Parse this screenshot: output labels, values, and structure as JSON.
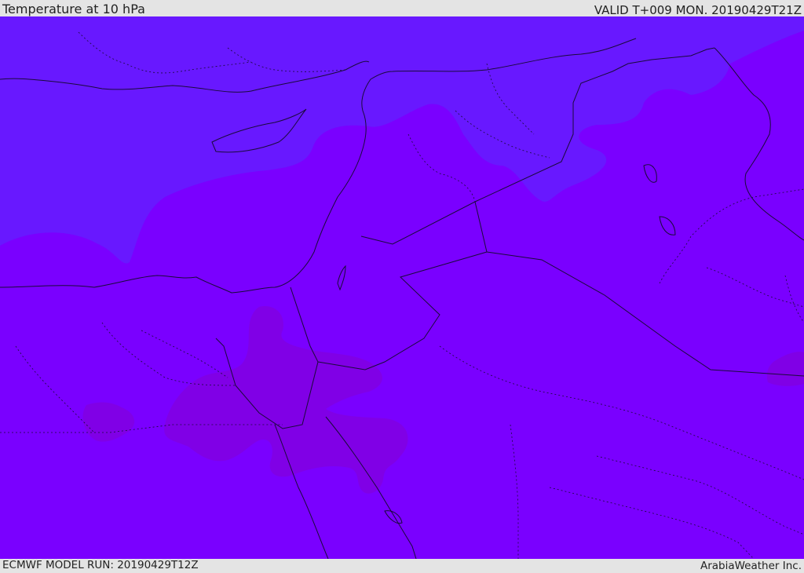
{
  "header": {
    "title": "Temperature at 10 hPa",
    "valid": "VALID T+009 MON. 20190429T21Z"
  },
  "footer": {
    "model_run": "ECMWF MODEL RUN: 20190429T12Z",
    "credit": "ArabiaWeather Inc."
  },
  "map": {
    "colors": {
      "cold_zone": "#6818ff",
      "base_zone": "#7a00ff",
      "warm_zone": "#8000e6",
      "borders": "#1a0a3a"
    }
  }
}
